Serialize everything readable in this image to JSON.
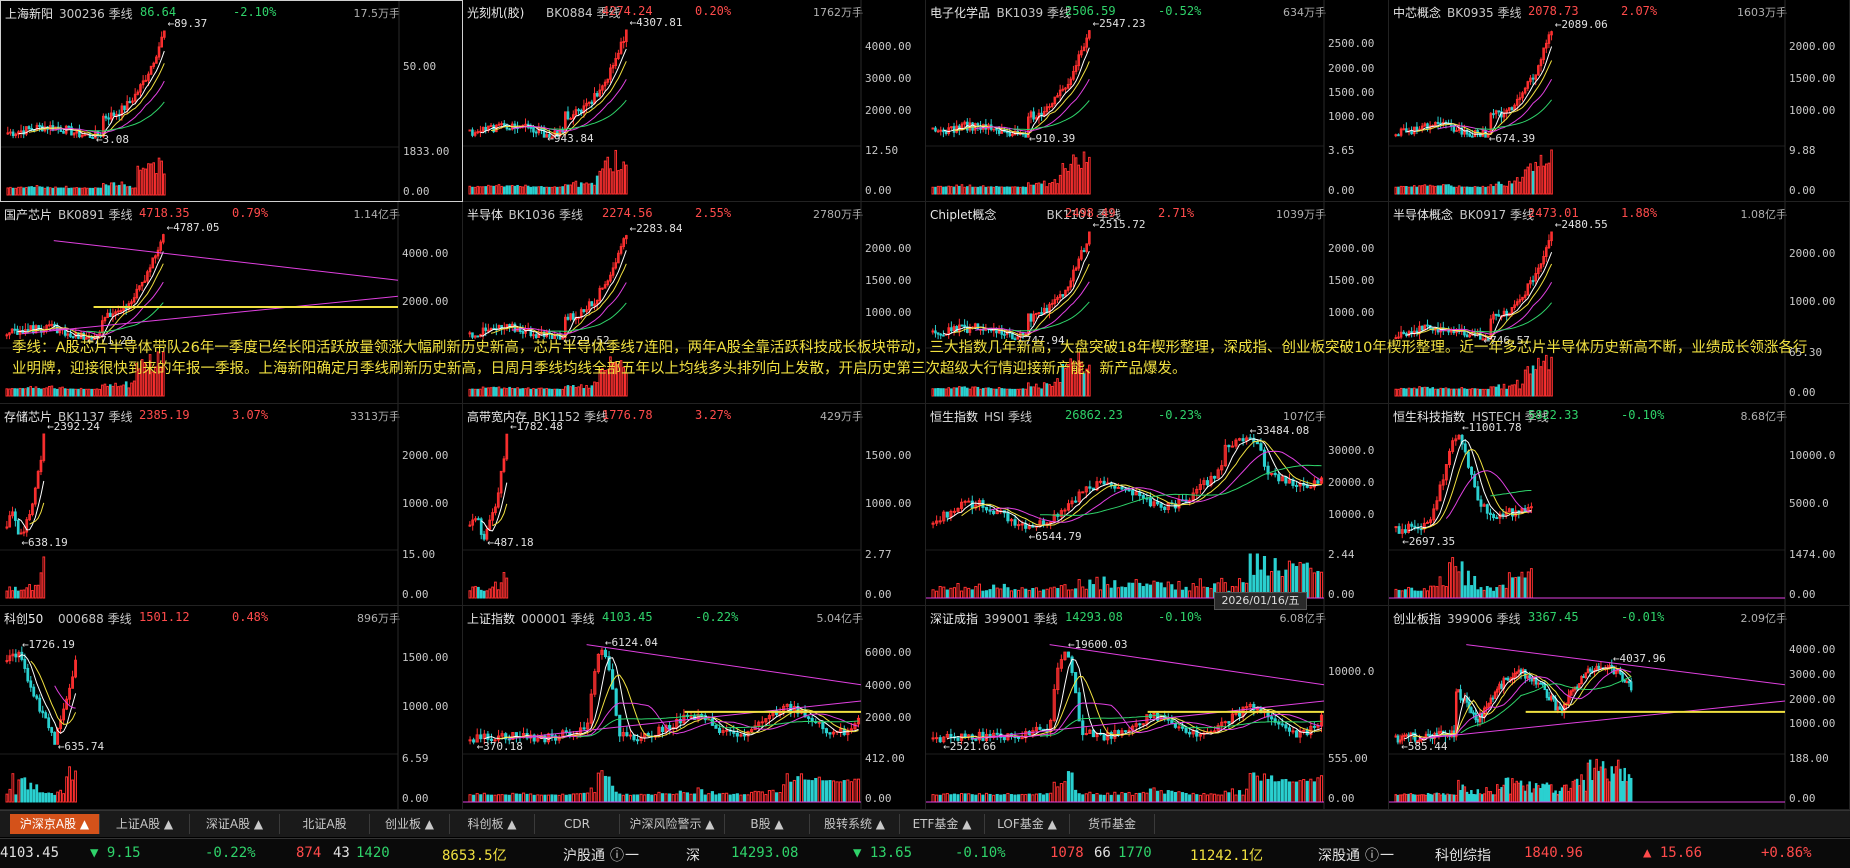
{
  "panels": [
    {
      "name": "上海新阳",
      "code": "300236",
      "period": "季线",
      "price": "86.64",
      "pct": "-2.10%",
      "vol": "17.5万手",
      "hi": "89.37",
      "lo": "3.08",
      "axis": [
        "50.00"
      ],
      "vaxis": [
        "1833.00",
        "0.00"
      ],
      "up": false,
      "selected": true,
      "pattern": "lateup"
    },
    {
      "name": "光刻机(胶)",
      "code": "BK0884",
      "period": "季线",
      "price": "4274.24",
      "pct": "0.20%",
      "vol": "1762万手",
      "hi": "4307.81",
      "lo": "943.84",
      "axis": [
        "4000.00",
        "3000.00",
        "2000.00"
      ],
      "vaxis": [
        "12.50",
        "0.00"
      ],
      "up": true,
      "pattern": "lateup"
    },
    {
      "name": "电子化学品",
      "code": "BK1039",
      "period": "季线",
      "price": "2506.59",
      "pct": "-0.52%",
      "vol": "634万手",
      "hi": "2547.23",
      "lo": "910.39",
      "axis": [
        "2500.00",
        "2000.00",
        "1500.00",
        "1000.00"
      ],
      "vaxis": [
        "3.65",
        "0.00"
      ],
      "up": false,
      "pattern": "lateup"
    },
    {
      "name": "中芯概念",
      "code": "BK0935",
      "period": "季线",
      "price": "2078.73",
      "pct": "2.07%",
      "vol": "1603万手",
      "hi": "2089.06",
      "lo": "674.39",
      "axis": [
        "2000.00",
        "1500.00",
        "1000.00"
      ],
      "vaxis": [
        "9.88",
        "0.00"
      ],
      "up": true,
      "pattern": "lateup"
    },
    {
      "name": "国产芯片",
      "code": "BK0891",
      "period": "季线",
      "price": "4718.35",
      "pct": "0.79%",
      "vol": "1.14亿手",
      "hi": "4787.05",
      "lo": "771.29",
      "axis": [
        "4000.00",
        "2000.00"
      ],
      "vaxis": [],
      "up": true,
      "pattern": "lateup"
    },
    {
      "name": "半导体",
      "code": "BK1036",
      "period": "季线",
      "price": "2274.56",
      "pct": "2.55%",
      "vol": "2780万手",
      "hi": "2283.84",
      "lo": "729.52",
      "axis": [
        "2000.00",
        "1500.00",
        "1000.00"
      ],
      "vaxis": [],
      "up": true,
      "pattern": "lateup"
    },
    {
      "name": "Chiplet概念",
      "code": "BK1101",
      "period": "季线",
      "price": "2498.49",
      "pct": "2.71%",
      "vol": "1039万手",
      "hi": "2515.72",
      "lo": "747.94",
      "axis": [
        "2000.00",
        "1500.00",
        "1000.00"
      ],
      "vaxis": [],
      "up": true,
      "pattern": "lateup"
    },
    {
      "name": "半导体概念",
      "code": "BK0917",
      "period": "季线",
      "price": "2473.01",
      "pct": "1.88%",
      "vol": "1.08亿手",
      "hi": "2480.55",
      "lo": "746.57",
      "axis": [
        "2000.00",
        "1000.00"
      ],
      "vaxis": [
        "65.30",
        "0.00"
      ],
      "up": true,
      "pattern": "lateup"
    },
    {
      "name": "存储芯片",
      "code": "BK1137",
      "period": "季线",
      "price": "2385.19",
      "pct": "3.07%",
      "vol": "3313万手",
      "hi": "2392.24",
      "lo": "638.19",
      "axis": [
        "2000.00",
        "1000.00"
      ],
      "vaxis": [
        "15.00",
        "0.00"
      ],
      "up": true,
      "pattern": "short"
    },
    {
      "name": "高带宽内存",
      "code": "BK1152",
      "period": "季线",
      "price": "1776.78",
      "pct": "3.27%",
      "vol": "429万手",
      "hi": "1782.48",
      "lo": "487.18",
      "axis": [
        "1500.00",
        "1000.00"
      ],
      "vaxis": [
        "2.77",
        "0.00"
      ],
      "up": true,
      "pattern": "short"
    },
    {
      "name": "恒生指数",
      "code": "HSI",
      "period": "季线",
      "price": "26862.23",
      "pct": "-0.23%",
      "vol": "107亿手",
      "hi": "33484.08",
      "lo": "6544.79",
      "axis": [
        "30000.0",
        "20000.0",
        "10000.0"
      ],
      "vaxis": [
        "2.44",
        "0.00"
      ],
      "up": false,
      "pattern": "long"
    },
    {
      "name": "恒生科技指数",
      "code": "HSTECH",
      "period": "季线",
      "price": "5822.33",
      "pct": "-0.10%",
      "vol": "8.68亿手",
      "hi": "11001.78",
      "lo": "2697.35",
      "axis": [
        "10000.0",
        "5000.0"
      ],
      "vaxis": [
        "1474.00",
        "0.00"
      ],
      "up": false,
      "pattern": "hump"
    },
    {
      "name": "科创50",
      "code": "000688",
      "period": "季线",
      "price": "1501.12",
      "pct": "0.48%",
      "vol": "896万手",
      "hi": "1726.19",
      "lo": "635.74",
      "axis": [
        "1500.00",
        "1000.00"
      ],
      "vaxis": [
        "6.59",
        "0.00"
      ],
      "up": true,
      "pattern": "vshape"
    },
    {
      "name": "上证指数",
      "code": "000001",
      "period": "季线",
      "price": "4103.45",
      "pct": "-0.22%",
      "vol": "5.04亿手",
      "hi": "6124.04",
      "lo": "370.18",
      "axis": [
        "6000.00",
        "4000.00",
        "2000.00"
      ],
      "vaxis": [
        "412.00",
        "0.00"
      ],
      "up": false,
      "pattern": "index"
    },
    {
      "name": "深证成指",
      "code": "399001",
      "period": "季线",
      "price": "14293.08",
      "pct": "-0.10%",
      "vol": "6.08亿手",
      "hi": "19600.03",
      "lo": "2521.66",
      "axis": [
        "10000.0"
      ],
      "vaxis": [
        "555.00",
        "0.00"
      ],
      "up": false,
      "pattern": "index"
    },
    {
      "name": "创业板指",
      "code": "399006",
      "period": "季线",
      "price": "3367.45",
      "pct": "-0.01%",
      "vol": "2.09亿手",
      "hi": "4037.96",
      "lo": "585.44",
      "axis": [
        "4000.00",
        "3000.00",
        "2000.00",
        "1000.00"
      ],
      "vaxis": [
        "188.00",
        "0.00"
      ],
      "up": false,
      "pattern": "cyb"
    }
  ],
  "note": "季线：A股芯片半导体带队26年一季度已经长阳活跃放量领涨大幅刷新历史新高，芯片半导体季线7连阳，两年A股全靠活跃科技成长板块带动，三大指数几年新高，大盘突破18年楔形整理，深成指、创业板突破10年楔形整理。近一年多芯片半导体历史新高不断，业绩成长领涨各行业明牌，迎接很快到来的年报一季报。上海新阳确定月季线刷新历史新高，日周月季线均线全部五年以上均线多头排列向上发散，开启历史第三次超级大行情迎接新产能、新产品爆发。",
  "date_tag": "2026/01/16/五",
  "tabs": [
    {
      "label": "沪深京A股",
      "arrow": true,
      "active": true
    },
    {
      "label": "上证A股",
      "arrow": true
    },
    {
      "label": "深证A股",
      "arrow": true
    },
    {
      "label": "北证A股",
      "arrow": false
    },
    {
      "label": "创业板",
      "arrow": true
    },
    {
      "label": "科创板",
      "arrow": true
    },
    {
      "label": "CDR",
      "arrow": false
    },
    {
      "label": "沪深风险警示",
      "arrow": true
    },
    {
      "label": "B股",
      "arrow": true
    },
    {
      "label": "股转系统",
      "arrow": true
    },
    {
      "label": "ETF基金",
      "arrow": true
    },
    {
      "label": "LOF基金",
      "arrow": true
    },
    {
      "label": "货币基金",
      "arrow": false
    }
  ],
  "status": {
    "sh_price": "4103.45",
    "sh_chg": "▼ 9.15",
    "sh_pct": "-0.22%",
    "sh_up": "874",
    "sh_flat": "43",
    "sh_down": "1420",
    "sh_amt": "8653.5亿",
    "sh_conn": "沪股通",
    "sh_conn_val": "一",
    "sz_label": "深",
    "sz_price": "14293.08",
    "sz_chg": "▼ 13.65",
    "sz_pct": "-0.10%",
    "sz_up": "1078",
    "sz_flat": "66",
    "sz_down": "1770",
    "sz_amt": "11242.1亿",
    "sz_conn": "深股通",
    "sz_conn_val": "一",
    "kc_label": "科创综指",
    "kc_price": "1840.96",
    "kc_chg": "▲ 15.66",
    "kc_pct": "+0.86%"
  },
  "colors": {
    "up": "#ff4b4b",
    "down": "#2fd36a",
    "ma5": "#ffffff",
    "ma10": "#f0e040",
    "ma20": "#e040e0",
    "ma60": "#2fd36a",
    "trend": "#e040e0",
    "candle_up": "#ff3030",
    "candle_down": "#2ad0d0",
    "accent": "#d4521a"
  }
}
